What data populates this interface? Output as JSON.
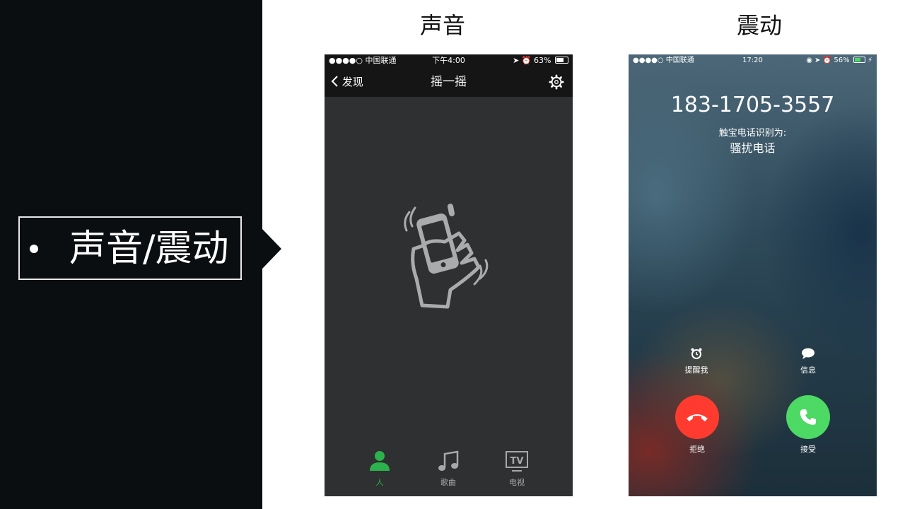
{
  "left_label": {
    "bullet": "•",
    "text": "声音/震动"
  },
  "section_titles": {
    "sound": "声音",
    "vibration": "震动"
  },
  "phone_sound": {
    "status": {
      "signal": "●●●●○ 中国联通",
      "time": "下午4:00",
      "battery": "63%"
    },
    "nav": {
      "back_label": "发现",
      "title": "摇一摇"
    },
    "tabs": [
      {
        "label": "人",
        "icon": "person-icon",
        "active": true
      },
      {
        "label": "歌曲",
        "icon": "music-note-icon",
        "active": false
      },
      {
        "label": "电视",
        "icon": "tv-icon",
        "active": false
      }
    ],
    "colors": {
      "active": "#2bb24c",
      "inactive": "#a8a8a8",
      "background": "#2e3031"
    }
  },
  "phone_vibration": {
    "status": {
      "signal": "●●●●○ 中国联通",
      "time": "17:20",
      "battery": "56%"
    },
    "caller_number": "183-1705-3557",
    "caller_sub": "触宝电话识别为:",
    "caller_tag": "骚扰电话",
    "actions": {
      "remind": "提醒我",
      "message": "信息",
      "decline": "拒绝",
      "accept": "接受"
    },
    "colors": {
      "decline": "#ff3b30",
      "accept": "#4cd964"
    }
  }
}
